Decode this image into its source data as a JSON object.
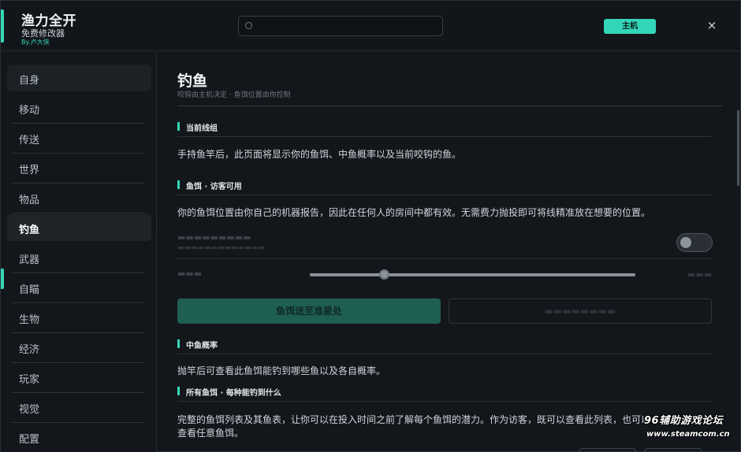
{
  "app": {
    "title": "渔力全开",
    "subtitle": "免费修改器",
    "author": "By.卢大侠"
  },
  "search": {
    "placeholder": "",
    "value": ""
  },
  "header": {
    "host_label": "主机",
    "close_icon": "×"
  },
  "sidebar": {
    "items": [
      {
        "label": "自身"
      },
      {
        "label": "移动"
      },
      {
        "label": "传送"
      },
      {
        "label": "世界"
      },
      {
        "label": "物品"
      },
      {
        "label": "钓鱼"
      },
      {
        "label": "武器"
      },
      {
        "label": "自瞄"
      },
      {
        "label": "生物"
      },
      {
        "label": "经济"
      },
      {
        "label": "玩家"
      },
      {
        "label": "视觉"
      },
      {
        "label": "配置"
      }
    ],
    "active": "钓鱼"
  },
  "main": {
    "title": "钓鱼",
    "subtitle": "咬钩由主机决定 · 鱼饵位置由你控制",
    "sections": [
      {
        "title": "当前线组",
        "text": "手持鱼竿后，此页面将显示你的鱼饵、中鱼概率以及当前咬钩的鱼。"
      },
      {
        "title": "鱼饵 · 访客可用",
        "text": "你的鱼饵位置由你自己的机器报告，因此在任何人的房间中都有效。无需费力抛投即可将线精准放在想要的位置。"
      },
      {
        "title": "中鱼概率",
        "text": "抛竿后可查看此鱼饵能钓到哪些鱼以及各自概率。"
      },
      {
        "title": "所有鱼饵 · 每种能钓到什么",
        "text": "完整的鱼饵列表及其鱼表，让你可以在投入时间之前了解每个鱼饵的潜力。作为访客，既可以查看此列表，也可以查看任意鱼饵。"
      }
    ],
    "toggle": {
      "on": false
    },
    "primary_button": "鱼饵送至准星处"
  },
  "colors": {
    "accent": "#33d6b9",
    "background": "#13171b",
    "primary_button": "#1f5f53"
  },
  "watermark": {
    "line1": "96辅助游戏论坛",
    "line2": "www.steamcom.cn"
  }
}
